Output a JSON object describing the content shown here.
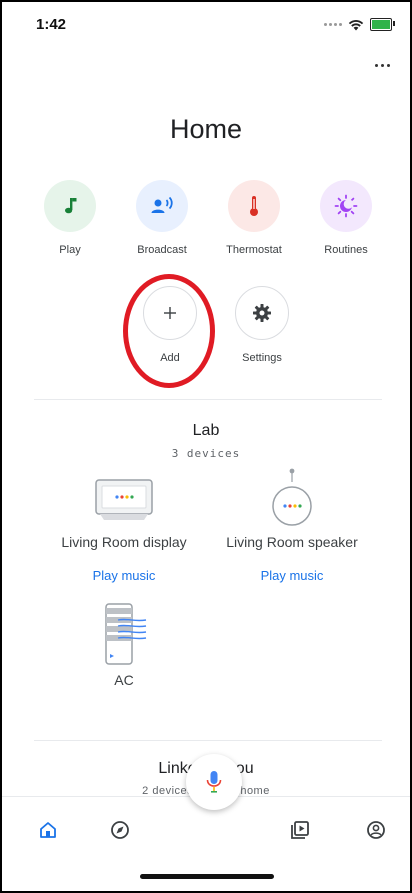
{
  "status": {
    "time": "1:42"
  },
  "header": {
    "title": "Home"
  },
  "actions": [
    {
      "label": "Play",
      "icon": "music-note-icon",
      "bg": "#e6f4ea",
      "fg": "#188038"
    },
    {
      "label": "Broadcast",
      "icon": "broadcast-icon",
      "bg": "#e8f0fe",
      "fg": "#1a73e8"
    },
    {
      "label": "Thermostat",
      "icon": "thermostat-icon",
      "bg": "#fce8e6",
      "fg": "#d93025"
    },
    {
      "label": "Routines",
      "icon": "routines-icon",
      "bg": "#f3e8fd",
      "fg": "#a142f4"
    }
  ],
  "secondary_actions": [
    {
      "label": "Add",
      "icon": "plus-icon"
    },
    {
      "label": "Settings",
      "icon": "gear-icon"
    }
  ],
  "rooms": [
    {
      "name": "Lab",
      "device_count": "3 devices",
      "devices": [
        {
          "name": "Living Room display",
          "action": "Play music",
          "icon": "smart-display-icon"
        },
        {
          "name": "Living Room speaker",
          "action": "Play music",
          "icon": "smart-speaker-icon"
        },
        {
          "name": "AC",
          "icon": "air-conditioner-icon"
        }
      ]
    }
  ],
  "linked": {
    "title": "Linked to you",
    "subtitle": "2 devices not in a home"
  },
  "nav": [
    {
      "icon": "home-icon",
      "active": true
    },
    {
      "icon": "discover-icon"
    },
    {
      "icon": "media-icon"
    },
    {
      "icon": "account-icon"
    }
  ],
  "colors": {
    "accent": "#1a73e8",
    "annotation": "#e01b24"
  }
}
